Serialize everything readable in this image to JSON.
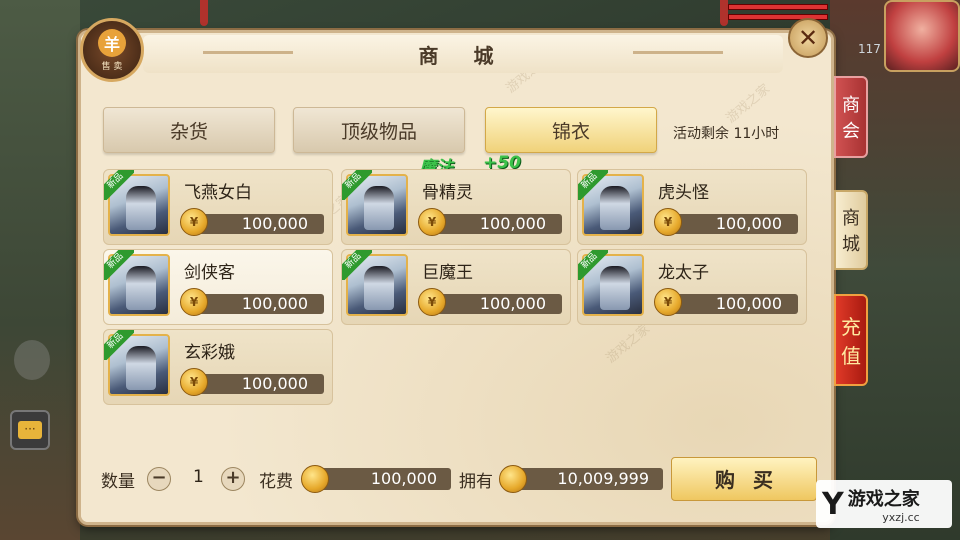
{
  "window": {
    "title": "商 城"
  },
  "sell_button": {
    "label": "售 卖",
    "glyph": "羊"
  },
  "close_button": {
    "glyph": "✕"
  },
  "tabs": [
    {
      "label": "杂货",
      "active": false
    },
    {
      "label": "顶级物品",
      "active": false
    },
    {
      "label": "锦衣",
      "active": true
    }
  ],
  "activity_text": "活动剩余 11小时",
  "float_text": {
    "stat": "魔法",
    "amount": "+50"
  },
  "items": [
    {
      "name": "飞燕女白",
      "price": "100,000",
      "badge": "新品",
      "selected": false
    },
    {
      "name": "骨精灵",
      "price": "100,000",
      "badge": "新品",
      "selected": false
    },
    {
      "name": "虎头怪",
      "price": "100,000",
      "badge": "新品",
      "selected": false
    },
    {
      "name": "剑侠客",
      "price": "100,000",
      "badge": "新品",
      "selected": true
    },
    {
      "name": "巨魔王",
      "price": "100,000",
      "badge": "新品",
      "selected": false
    },
    {
      "name": "龙太子",
      "price": "100,000",
      "badge": "新品",
      "selected": false
    },
    {
      "name": "玄彩娥",
      "price": "100,000",
      "badge": "新品",
      "selected": false
    }
  ],
  "bottom": {
    "quantity_label": "数量",
    "quantity_value": "1",
    "minus": "−",
    "plus": "+",
    "cost_label": "花费",
    "cost_value": "100,000",
    "owned_label": "拥有",
    "owned_value": "10,009,999",
    "buy_label": "购买"
  },
  "side_tabs": {
    "guild": [
      "商",
      "会"
    ],
    "mall": [
      "商",
      "城"
    ],
    "charge": [
      "充",
      "值"
    ]
  },
  "hud": {
    "level_number": "117"
  },
  "logo": {
    "mark": "Y",
    "name": "游戏之家",
    "site": "yxzj.cc"
  },
  "colors": {
    "accent_gold": "#efc760",
    "badge_green": "#2e9a2e",
    "price_bar": "#6b5a44",
    "float_green": "#3cc24a"
  }
}
